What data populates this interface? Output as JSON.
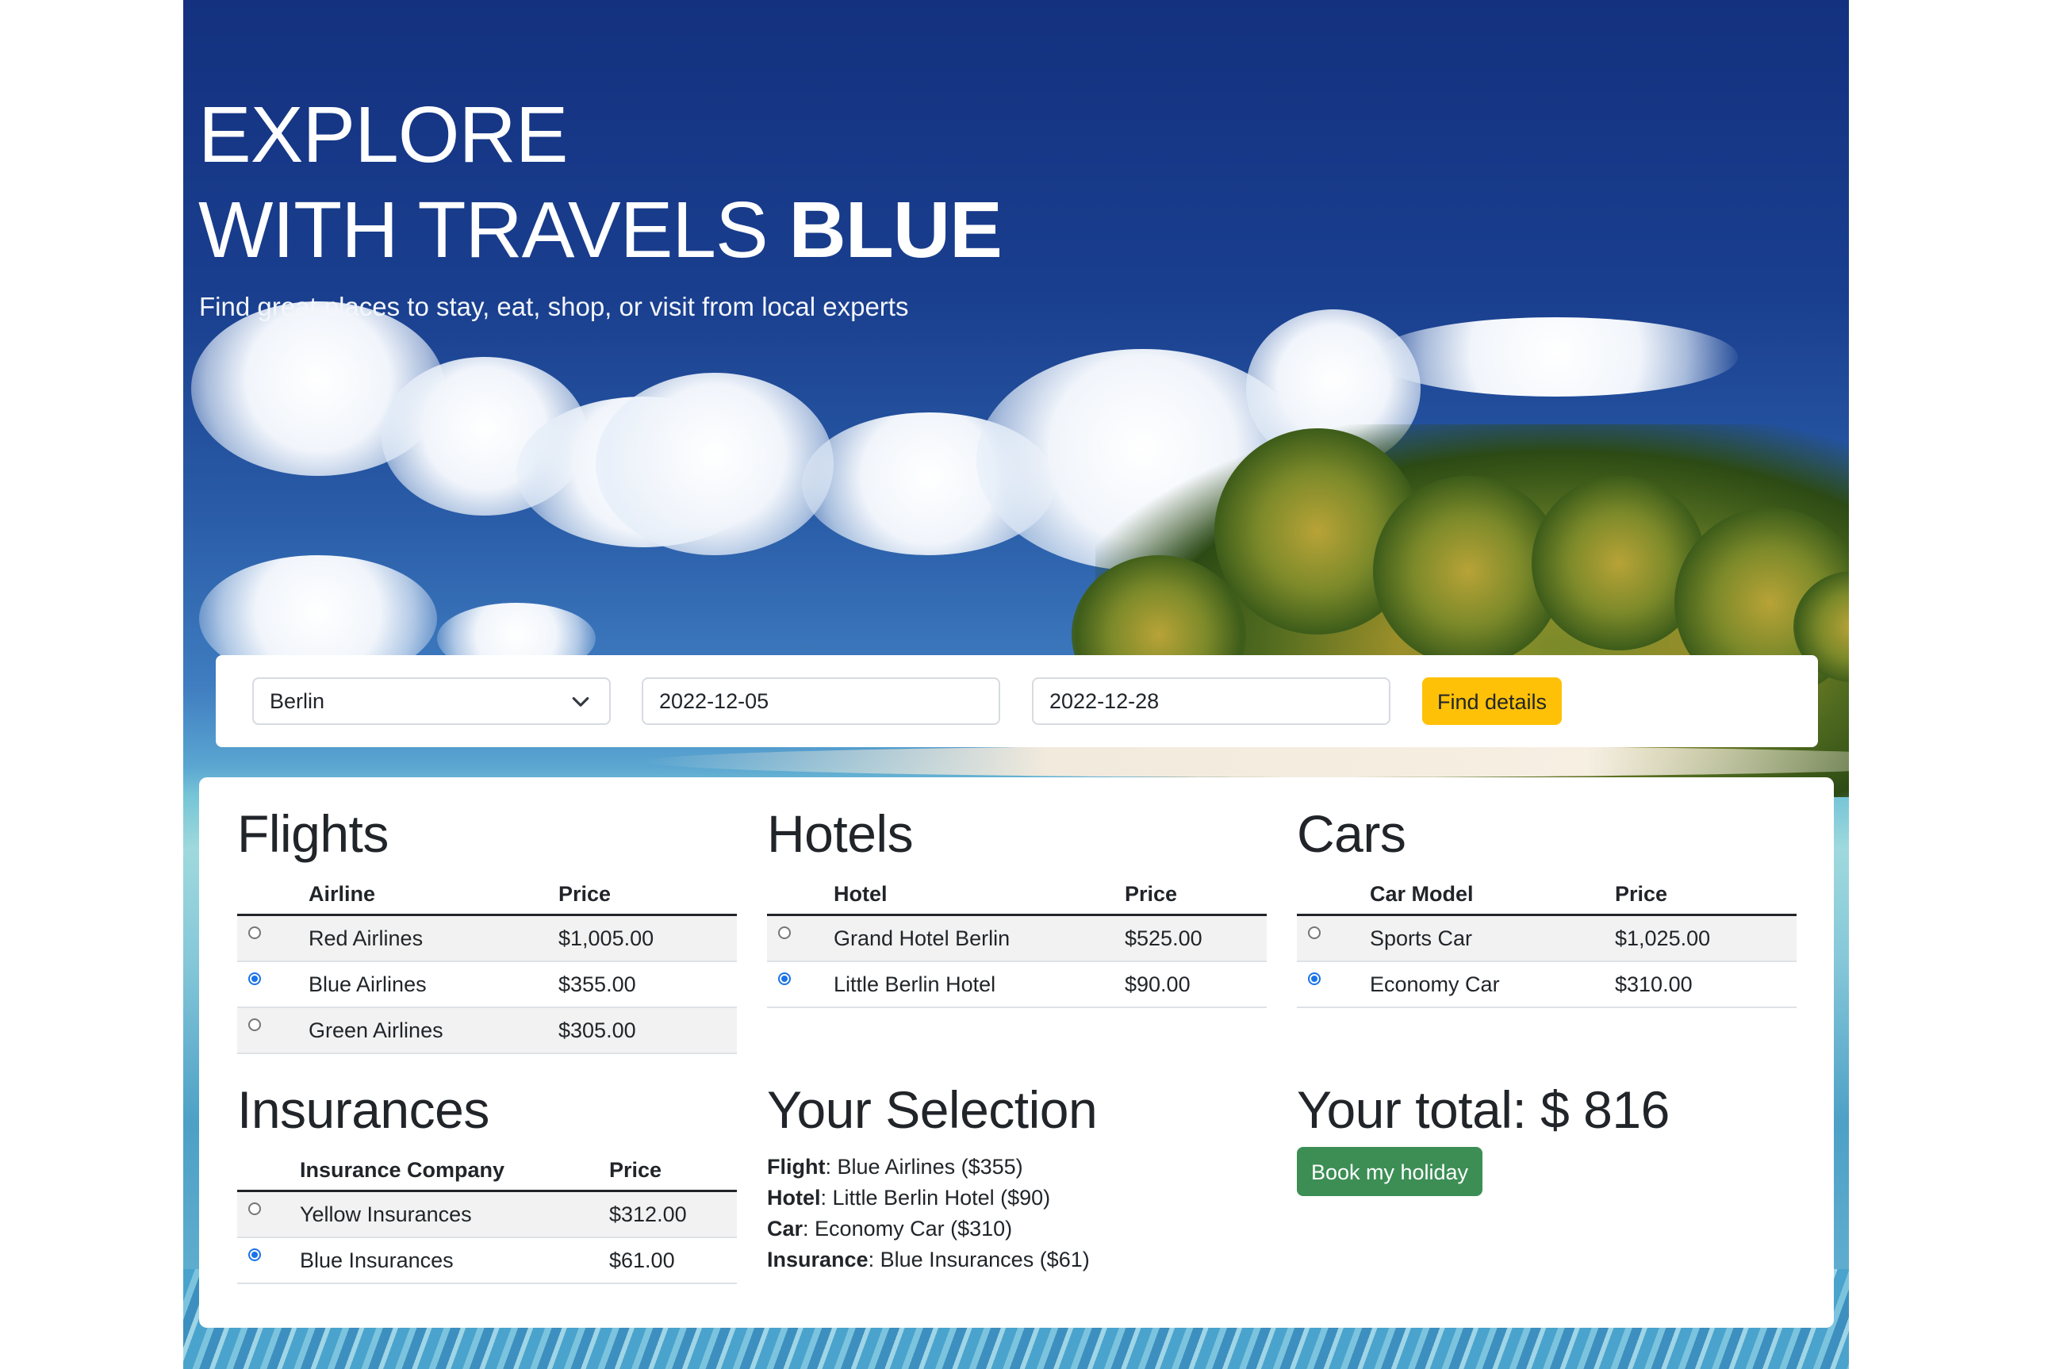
{
  "hero": {
    "line1": "EXPLORE",
    "line2_prefix": "WITH TRAVELS",
    "line2_bold": "BLUE",
    "subtitle": "Find great places to stay, eat, shop, or visit from local experts"
  },
  "search": {
    "destination": "Berlin",
    "start_date": "2022-12-05",
    "end_date": "2022-12-28",
    "find_label": "Find details"
  },
  "flights": {
    "title": "Flights",
    "columns": [
      "Airline",
      "Price"
    ],
    "rows": [
      {
        "name": "Red Airlines",
        "price": "$1,005.00",
        "selected": false
      },
      {
        "name": "Blue Airlines",
        "price": "$355.00",
        "selected": true
      },
      {
        "name": "Green Airlines",
        "price": "$305.00",
        "selected": false
      }
    ]
  },
  "hotels": {
    "title": "Hotels",
    "columns": [
      "Hotel",
      "Price"
    ],
    "rows": [
      {
        "name": "Grand Hotel Berlin",
        "price": "$525.00",
        "selected": false
      },
      {
        "name": "Little Berlin Hotel",
        "price": "$90.00",
        "selected": true
      }
    ]
  },
  "cars": {
    "title": "Cars",
    "columns": [
      "Car Model",
      "Price"
    ],
    "rows": [
      {
        "name": "Sports Car",
        "price": "$1,025.00",
        "selected": false
      },
      {
        "name": "Economy Car",
        "price": "$310.00",
        "selected": true
      }
    ]
  },
  "insurances": {
    "title": "Insurances",
    "columns": [
      "Insurance Company",
      "Price"
    ],
    "rows": [
      {
        "name": "Yellow Insurances",
        "price": "$312.00",
        "selected": false
      },
      {
        "name": "Blue Insurances",
        "price": "$61.00",
        "selected": true
      }
    ]
  },
  "selection": {
    "title": "Your Selection",
    "flight_label": "Flight",
    "flight_value": "Blue Airlines ($355)",
    "hotel_label": "Hotel",
    "hotel_value": "Little Berlin Hotel ($90)",
    "car_label": "Car",
    "car_value": "Economy Car ($310)",
    "insurance_label": "Insurance",
    "insurance_value": "Blue Insurances ($61)"
  },
  "total": {
    "title": "Your total: $ 816",
    "book_label": "Book my holiday"
  },
  "colors": {
    "find_button": "#ffc107",
    "book_button": "#3c8e55",
    "radio_selected": "#1a73e8"
  }
}
